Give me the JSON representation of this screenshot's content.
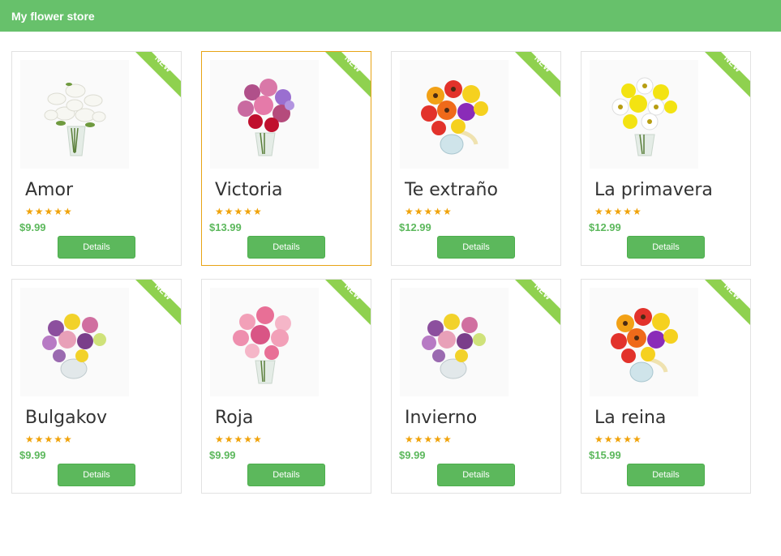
{
  "app": {
    "title": "My flower store"
  },
  "colors": {
    "header": "#67c16b",
    "accent": "#5cb85c",
    "badge": "#8fd14f",
    "star": "#f0a30a",
    "selected_border": "#e8a415"
  },
  "products": [
    {
      "name": "Amor",
      "price": "$9.99",
      "badge": "NEW",
      "rating": 5,
      "stars": "★★★★★",
      "button": "Details",
      "image": "white-lily-bouquet"
    },
    {
      "name": "Victoria",
      "price": "$13.99",
      "badge": "NEW",
      "rating": 5,
      "stars": "★★★★★",
      "button": "Details",
      "image": "pink-purple-bouquet",
      "selected": true
    },
    {
      "name": "Te extraño",
      "price": "$12.99",
      "badge": "NEW",
      "rating": 5,
      "stars": "★★★★★",
      "button": "Details",
      "image": "gerbera-daisy-bouquet"
    },
    {
      "name": "La primavera",
      "price": "$12.99",
      "badge": "NEW",
      "rating": 5,
      "stars": "★★★★★",
      "button": "Details",
      "image": "yellow-white-daisy-bouquet"
    },
    {
      "name": "Bulgakov",
      "price": "$9.99",
      "badge": "NEW",
      "rating": 5,
      "stars": "★★★★★",
      "button": "Details",
      "image": "mixed-purple-bouquet"
    },
    {
      "name": "Roja",
      "price": "$9.99",
      "badge": "NEW",
      "rating": 5,
      "stars": "★★★★★",
      "button": "Details",
      "image": "pink-lily-bouquet"
    },
    {
      "name": "Invierno",
      "price": "$9.99",
      "badge": "NEW",
      "rating": 5,
      "stars": "★★★★★",
      "button": "Details",
      "image": "mixed-purple-bouquet"
    },
    {
      "name": "La reina",
      "price": "$15.99",
      "badge": "NEW",
      "rating": 5,
      "stars": "★★★★★",
      "button": "Details",
      "image": "gerbera-daisy-bouquet"
    }
  ]
}
